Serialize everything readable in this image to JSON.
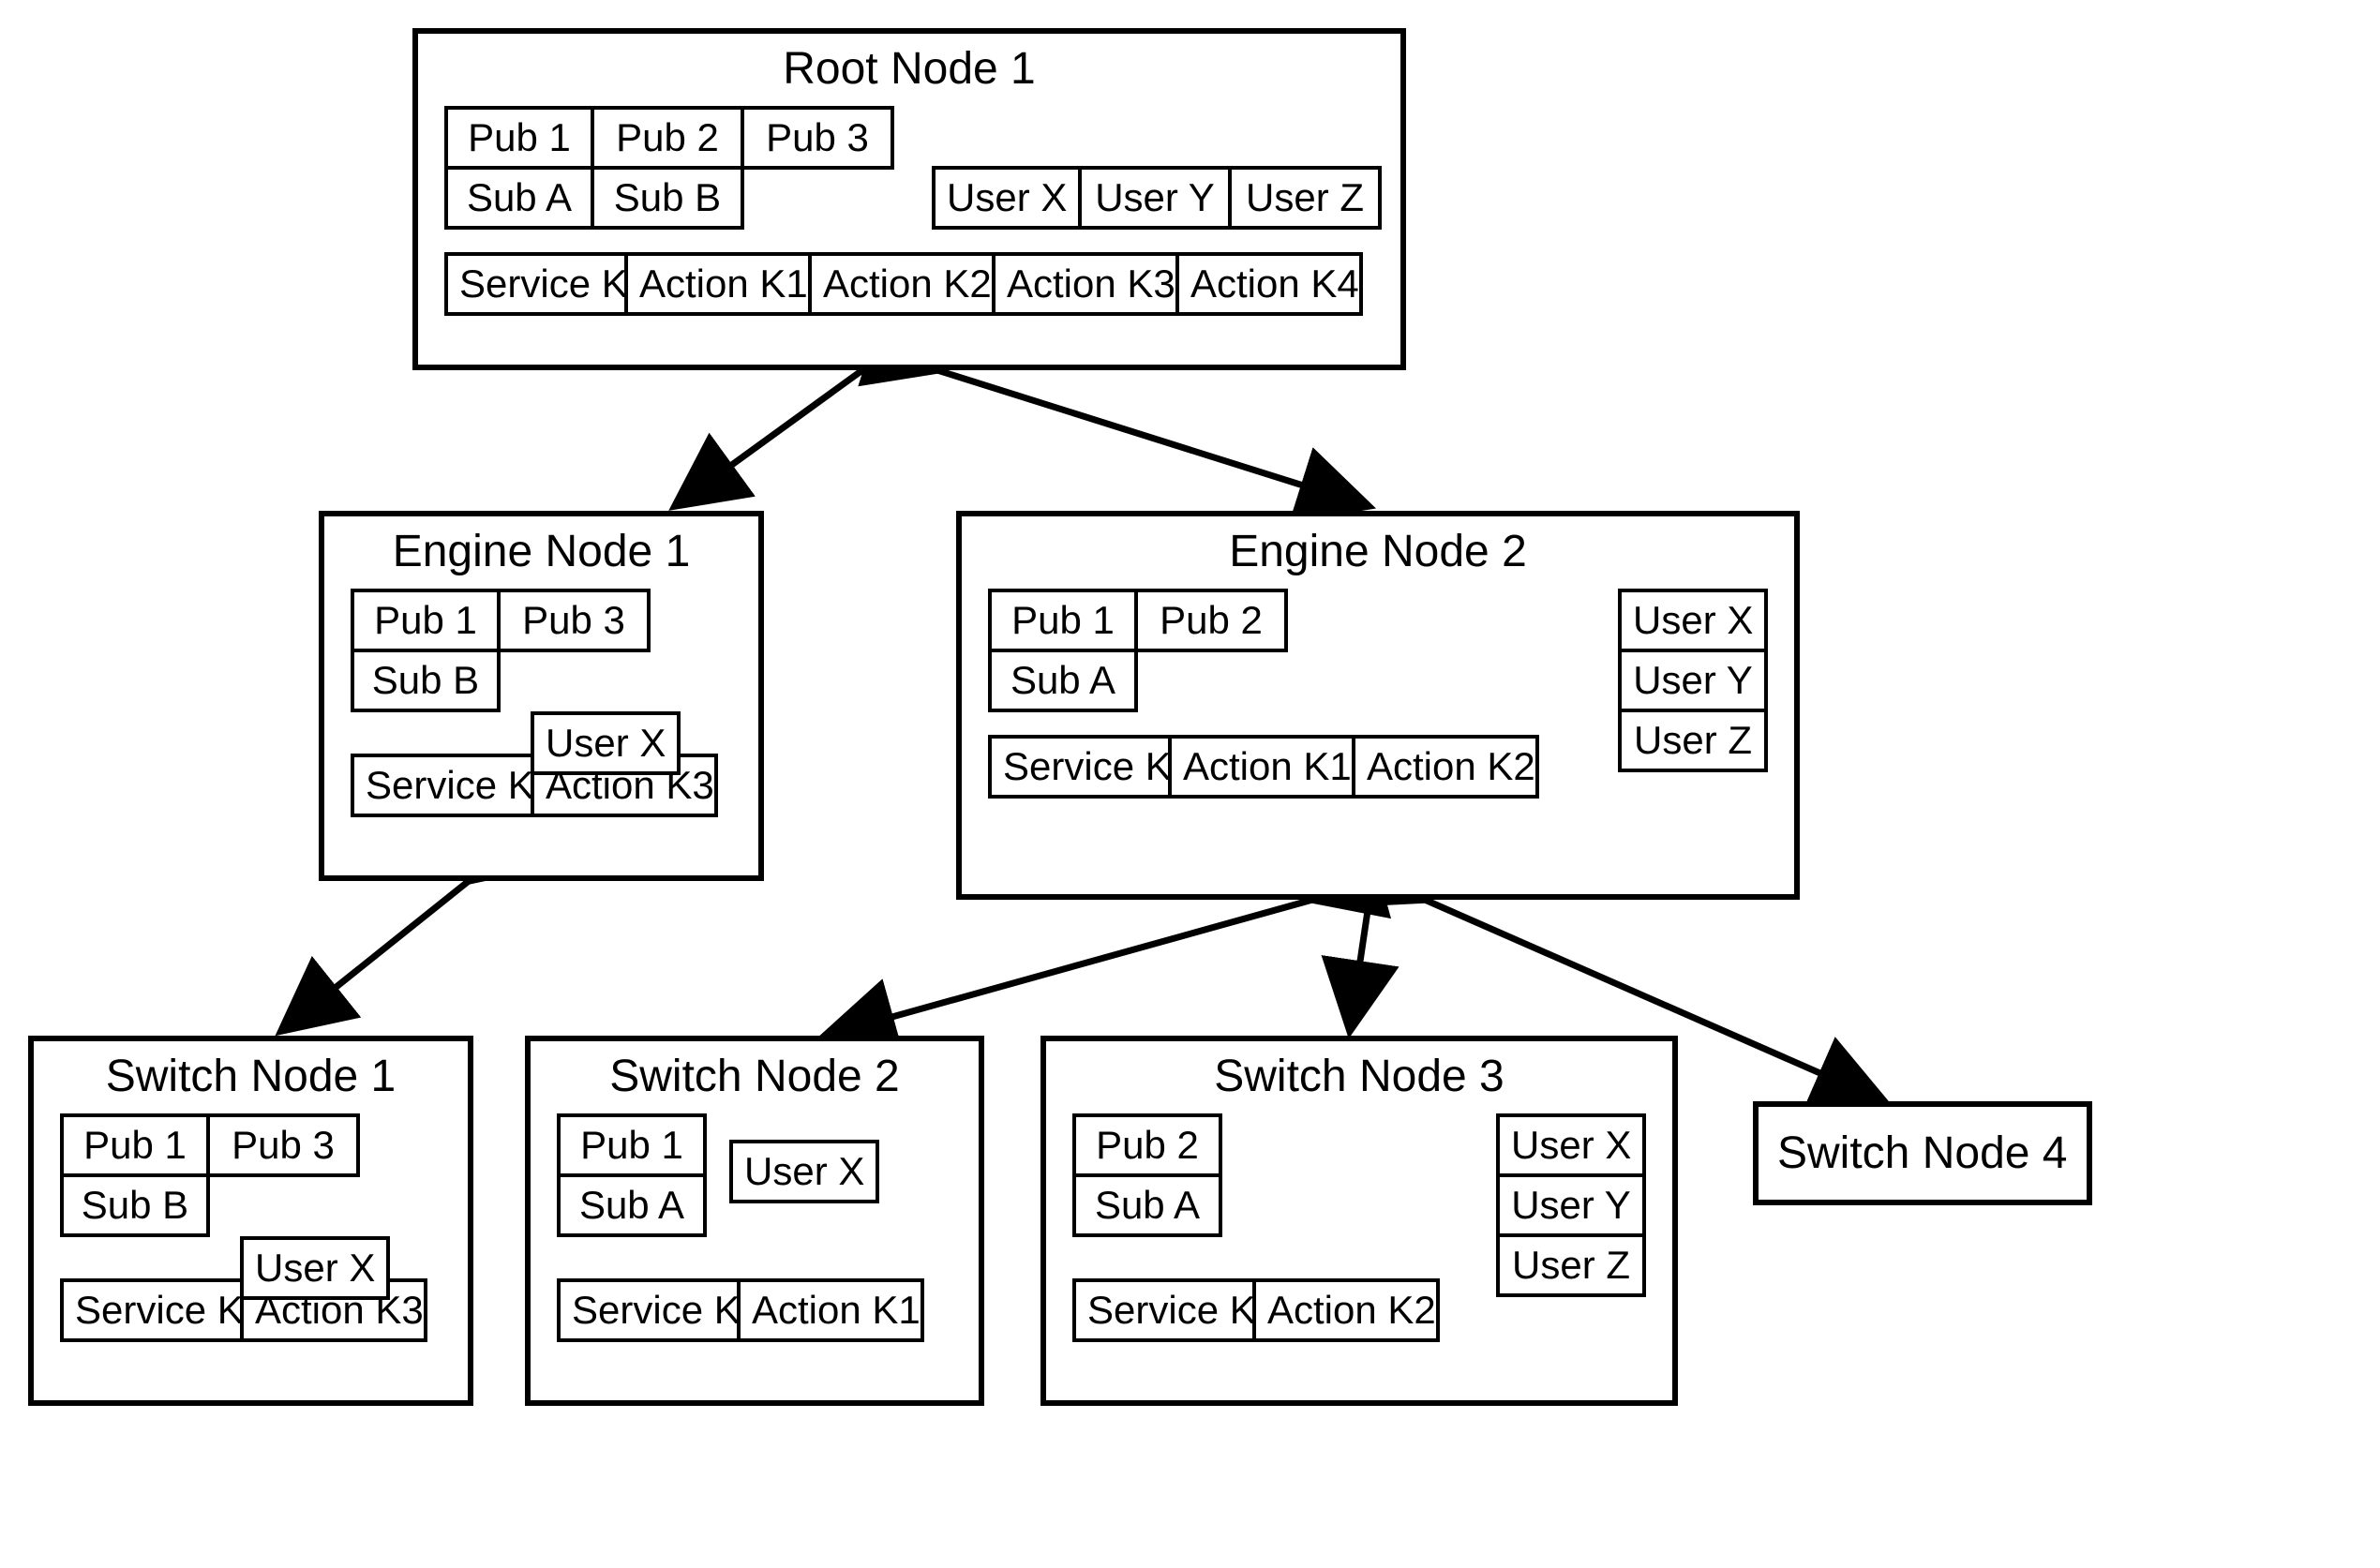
{
  "root": {
    "title": "Root Node 1",
    "pubs": [
      "Pub 1",
      "Pub 2",
      "Pub 3"
    ],
    "subs": [
      "Sub A",
      "Sub B"
    ],
    "users": [
      "User X",
      "User Y",
      "User Z"
    ],
    "services": [
      "Service K"
    ],
    "actions": [
      "Action K1",
      "Action K2",
      "Action K3",
      "Action K4"
    ]
  },
  "engine1": {
    "title": "Engine Node 1",
    "pubs": [
      "Pub 1",
      "Pub 3"
    ],
    "subs": [
      "Sub B"
    ],
    "users": [
      "User X"
    ],
    "services": [
      "Service K"
    ],
    "actions": [
      "Action K3"
    ]
  },
  "engine2": {
    "title": "Engine Node 2",
    "pubs": [
      "Pub 1",
      "Pub 2"
    ],
    "subs": [
      "Sub A"
    ],
    "users": [
      "User X",
      "User Y",
      "User Z"
    ],
    "services": [
      "Service K"
    ],
    "actions": [
      "Action K1",
      "Action K2"
    ]
  },
  "switch1": {
    "title": "Switch Node 1",
    "pubs": [
      "Pub 1",
      "Pub 3"
    ],
    "subs": [
      "Sub B"
    ],
    "users": [
      "User X"
    ],
    "services": [
      "Service K"
    ],
    "actions": [
      "Action K3"
    ]
  },
  "switch2": {
    "title": "Switch Node 2",
    "pubs": [
      "Pub 1"
    ],
    "subs": [
      "Sub A"
    ],
    "users": [
      "User X"
    ],
    "services": [
      "Service K"
    ],
    "actions": [
      "Action K1"
    ]
  },
  "switch3": {
    "title": "Switch Node 3",
    "pubs": [
      "Pub 2"
    ],
    "subs": [
      "Sub A"
    ],
    "users": [
      "User X",
      "User Y",
      "User Z"
    ],
    "services": [
      "Service K"
    ],
    "actions": [
      "Action K2"
    ]
  },
  "switch4": {
    "title": "Switch Node 4"
  }
}
